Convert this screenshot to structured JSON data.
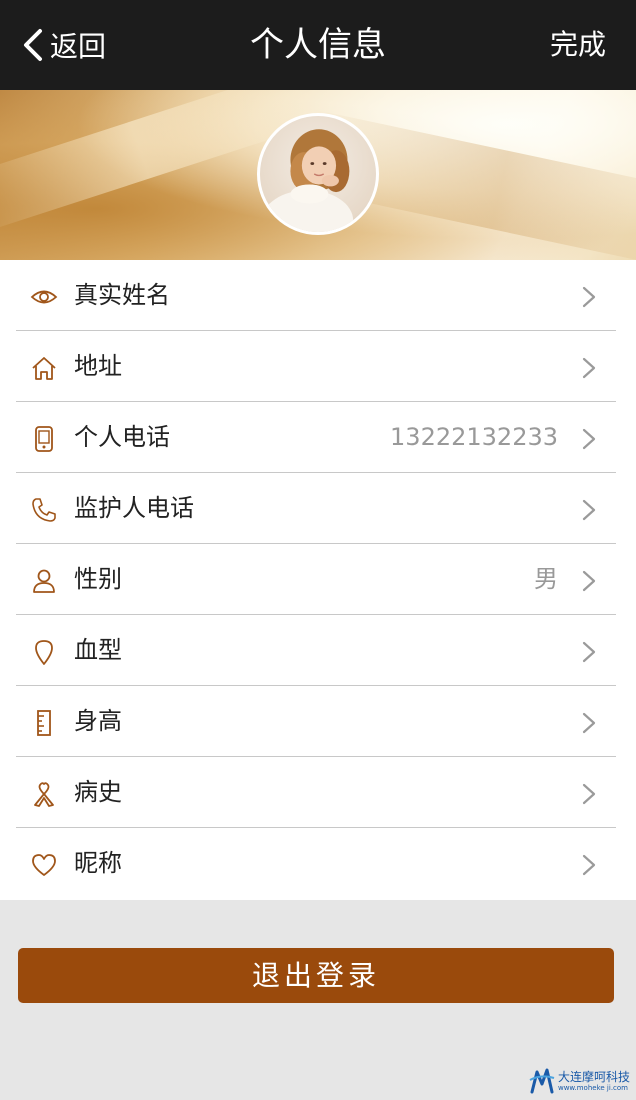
{
  "navbar": {
    "back_label": "返回",
    "title": "个人信息",
    "done_label": "完成"
  },
  "profile_rows": [
    {
      "label": "真实姓名",
      "value": "",
      "icon": "eye-icon"
    },
    {
      "label": "地址",
      "value": "",
      "icon": "home-icon"
    },
    {
      "label": "个人电话",
      "value": "13222132233",
      "icon": "mobile-phone-icon"
    },
    {
      "label": "监护人电话",
      "value": "",
      "icon": "telephone-icon"
    },
    {
      "label": "性别",
      "value": "男",
      "icon": "person-icon"
    },
    {
      "label": "血型",
      "value": "",
      "icon": "location-pin-icon"
    },
    {
      "label": "身高",
      "value": "",
      "icon": "ruler-icon"
    },
    {
      "label": "病史",
      "value": "",
      "icon": "ribbon-icon"
    },
    {
      "label": "昵称",
      "value": "",
      "icon": "heart-icon"
    }
  ],
  "logout_label": "退出登录",
  "watermark": {
    "name": "大连摩呵科技",
    "url": "www.moheke ji.com"
  },
  "colors": {
    "navbar_bg": "#1c1c1c",
    "icon_accent": "#a0561a",
    "logout_bg": "#9a4a0c",
    "page_bg": "#e6e6e6"
  }
}
